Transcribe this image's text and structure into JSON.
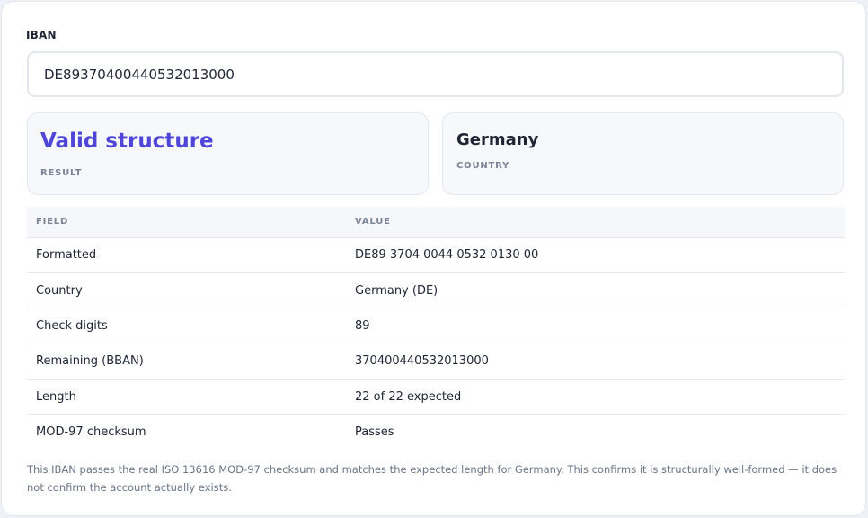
{
  "iban_field": {
    "label": "IBAN",
    "value": "DE89370400440532013000"
  },
  "result": {
    "value": "Valid structure",
    "caption": "RESULT",
    "color": "#4f46d8"
  },
  "country": {
    "value": "Germany",
    "caption": "COUNTRY"
  },
  "details_table": {
    "headers": [
      "FIELD",
      "VALUE"
    ],
    "rows": [
      {
        "field": "Formatted",
        "value": "DE89 3704 0044 0532 0130 00"
      },
      {
        "field": "Country",
        "value": "Germany (DE)"
      },
      {
        "field": "Check digits",
        "value": "89"
      },
      {
        "field": "Remaining (BBAN)",
        "value": "370400440532013000"
      },
      {
        "field": "Length",
        "value": "22 of 22 expected"
      },
      {
        "field": "MOD-97 checksum",
        "value": "Passes"
      }
    ]
  },
  "note": "This IBAN passes the real ISO 13616 MOD-97 checksum and matches the expected length for Germany. This confirms it is structurally well-formed — it does not confirm the account actually exists."
}
